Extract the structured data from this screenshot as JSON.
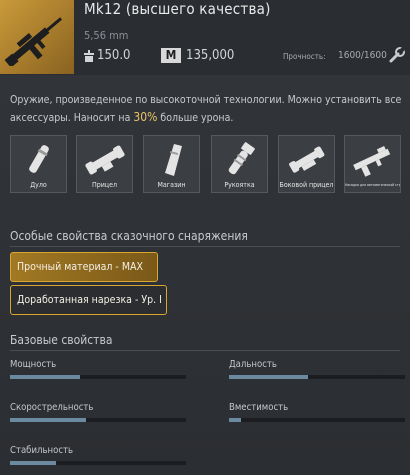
{
  "item": {
    "name": "Mk12 (высшего качества)",
    "caliber": "5,56 mm",
    "weight": "150.0",
    "money_symbol": "M",
    "price": "135,000",
    "durability_label": "Прочность:",
    "durability_value": "1600/1600"
  },
  "description": {
    "before": "Оружие, произведенное по высокоточной технологии. Можно установить все аксессуары. Наносит на ",
    "highlight": "30%",
    "after": " больше урона."
  },
  "slots": [
    {
      "label": "Дуло",
      "icon": "muzzle-icon"
    },
    {
      "label": "Прицел",
      "icon": "scope-icon"
    },
    {
      "label": "Магазин",
      "icon": "magazine-icon"
    },
    {
      "label": "Рукоятка",
      "icon": "grip-icon"
    },
    {
      "label": "Боковой прицел",
      "icon": "side-scope-icon"
    },
    {
      "label": "Насадка для автоматической стрельбы",
      "icon": "auto-fire-icon"
    }
  ],
  "special": {
    "title": "Особые свойства сказочного снаряжения",
    "perks": [
      "Прочный материал - MAX",
      "Доработанная нарезка - Ур. I"
    ]
  },
  "base": {
    "title": "Базовые свойства",
    "stats": [
      {
        "name": "Мощность",
        "level": 0.4
      },
      {
        "name": "Дальность",
        "level": 0.45
      },
      {
        "name": "Скорострельность",
        "level": 0.43
      },
      {
        "name": "Вместимость",
        "level": 0.07
      },
      {
        "name": "Стабильность",
        "level": 0.26
      }
    ]
  },
  "colors": {
    "accent": "#d9a632",
    "highlight": "#e9c46a",
    "bar_fill": "#6b8aa0"
  }
}
